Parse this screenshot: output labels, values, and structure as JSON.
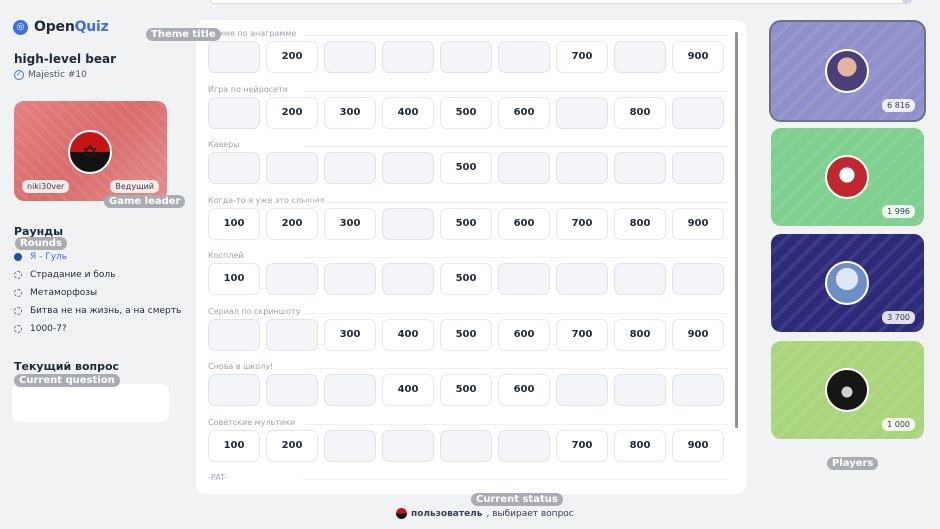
{
  "app": {
    "logo_part1": "Open",
    "logo_part2": "Quiz"
  },
  "user": {
    "name": "high-level bear",
    "badge": "Majestic #10"
  },
  "leader": {
    "name": "niki30ver",
    "role": "Ведущий"
  },
  "annotations": {
    "theme_title": "Theme title",
    "game_leader": "Game leader",
    "rounds": "Rounds",
    "current_question": "Current question",
    "current_status": "Current status",
    "players": "Players"
  },
  "rounds_title": "Раунды",
  "rounds": [
    {
      "label": "Я - Гуль",
      "state": "active"
    },
    {
      "label": "Страдание и боль",
      "state": "pending"
    },
    {
      "label": "Метаморфозы",
      "state": "pending"
    },
    {
      "label": "Битва не на жизнь, а на смерть",
      "state": "pending"
    },
    {
      "label": "1000-7?",
      "state": "pending"
    }
  ],
  "current_question_title": "Текущий вопрос",
  "themes": [
    {
      "name": "Аниме по анаграмме",
      "cells": [
        "",
        "200",
        "",
        "",
        "",
        "",
        "700",
        "",
        "900"
      ]
    },
    {
      "name": "Игра по нейросети",
      "cells": [
        "",
        "200",
        "300",
        "400",
        "500",
        "600",
        "",
        "800",
        ""
      ]
    },
    {
      "name": "Каверы",
      "cells": [
        "",
        "",
        "",
        "",
        "500",
        "",
        "",
        "",
        ""
      ]
    },
    {
      "name": "Когда-то я уже это слышал",
      "cells": [
        "100",
        "200",
        "300",
        "",
        "500",
        "600",
        "700",
        "800",
        "900"
      ]
    },
    {
      "name": "Косплей",
      "cells": [
        "100",
        "",
        "",
        "",
        "500",
        "",
        "",
        "",
        ""
      ]
    },
    {
      "name": "Сериал по скриншоту",
      "cells": [
        "",
        "",
        "300",
        "400",
        "500",
        "600",
        "700",
        "800",
        "900"
      ]
    },
    {
      "name": "Снова в школу!",
      "cells": [
        "",
        "",
        "",
        "400",
        "500",
        "600",
        "",
        "",
        ""
      ]
    },
    {
      "name": "Советские мультики",
      "cells": [
        "100",
        "200",
        "",
        "",
        "",
        "",
        "700",
        "800",
        "900"
      ]
    },
    {
      "name": "-PAT-",
      "cells": []
    }
  ],
  "status": {
    "user": "пользователь",
    "text": ", выбирает вопрос"
  },
  "players": [
    {
      "score": "6 816",
      "bg": "#8f8fcc",
      "selected": true
    },
    {
      "score": "1 996",
      "bg": "#7fcf8f",
      "selected": false
    },
    {
      "score": "3 700",
      "bg": "#2e2a7a",
      "selected": false
    },
    {
      "score": "1 000",
      "bg": "#a9d57c",
      "selected": false
    }
  ],
  "colors": {
    "accent": "#3b6fe0",
    "leader_card": "#e07b7b"
  }
}
